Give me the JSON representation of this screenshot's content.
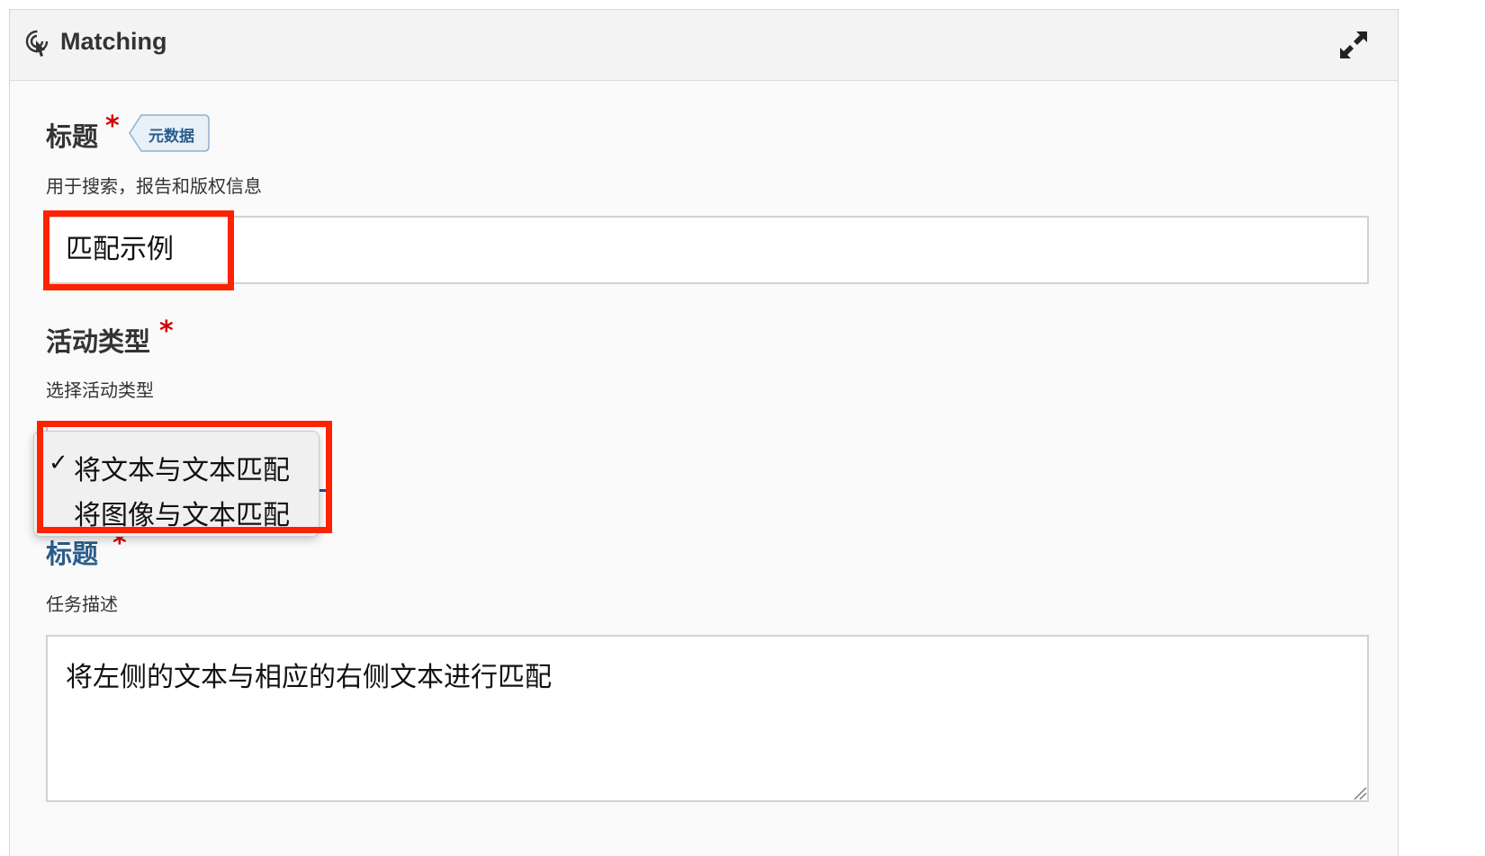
{
  "header": {
    "title": "Matching",
    "icon": "touch-hand-icon",
    "expand_icon": "expand-arrows-icon"
  },
  "title_field": {
    "label": "标题",
    "required_mark": "*",
    "metadata_tag": "元数据",
    "description": "用于搜索，报告和版权信息",
    "value": "匹配示例"
  },
  "activity_type_field": {
    "label": "活动类型",
    "required_mark": "*",
    "description": "选择活动类型",
    "options": [
      {
        "label": "将文本与文本匹配",
        "selected": true,
        "check": "✓"
      },
      {
        "label": "将图像与文本匹配",
        "selected": false,
        "check": ""
      }
    ]
  },
  "task_field": {
    "label": "标题",
    "required_mark": "*",
    "description": "任务描述",
    "value": "将左侧的文本与相应的右侧文本进行匹配"
  },
  "colors": {
    "highlight": "#ff2200",
    "required": "#d40000",
    "select_focus": "#1f4e9a",
    "link_label": "#2a5c8a"
  }
}
